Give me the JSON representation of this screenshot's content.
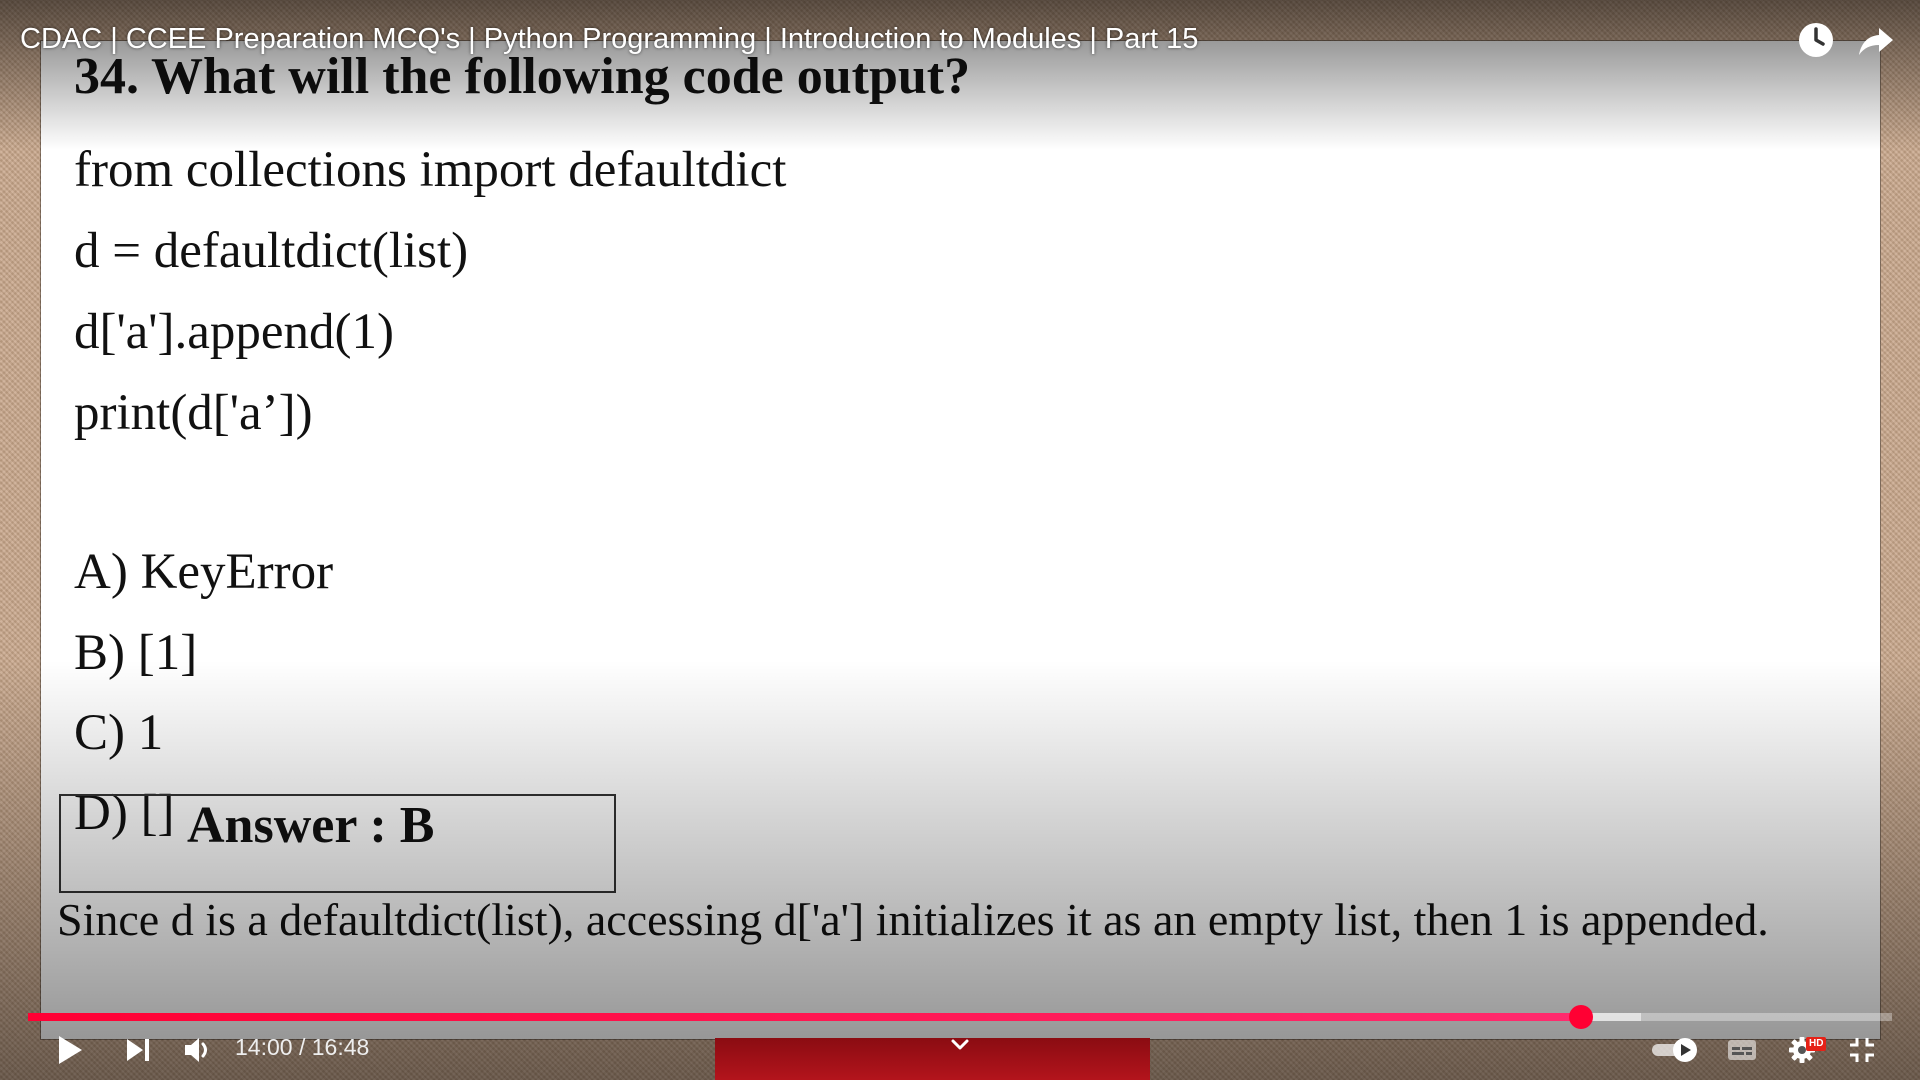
{
  "video": {
    "title": "CDAC | CCEE Preparation MCQ's | Python Programming | Introduction to Modules | Part 15"
  },
  "slide": {
    "question_title": "34. What will the following code output?",
    "code_lines": [
      "from collections import defaultdict",
      "d = defaultdict(list)",
      "d['a'].append(1)",
      "print(d['a’])"
    ],
    "options": [
      "A) KeyError",
      "B) [1]",
      "C) 1",
      "D) []"
    ],
    "answer_label": "Answer : B",
    "explanation": "Since d is a defaultdict(list), accessing d['a'] initializes it as an empty list, then 1 is appended."
  },
  "player": {
    "current_time": "14:00",
    "time_separator": " / ",
    "duration": "16:48",
    "progress_fraction": 0.8333,
    "buffered_fraction": 0.8651,
    "accent_color": "#ff0033",
    "hd_label": "HD",
    "icons": {
      "watch_later": "clock-icon",
      "share": "share-icon",
      "play": "play-icon",
      "next": "next-icon",
      "volume": "volume-icon",
      "autoplay": "autoplay-toggle-icon",
      "captions": "captions-icon",
      "settings": "gear-icon",
      "fullscreen_exit": "exit-fullscreen-icon",
      "overlay_expand": "chevron-down-icon"
    }
  }
}
